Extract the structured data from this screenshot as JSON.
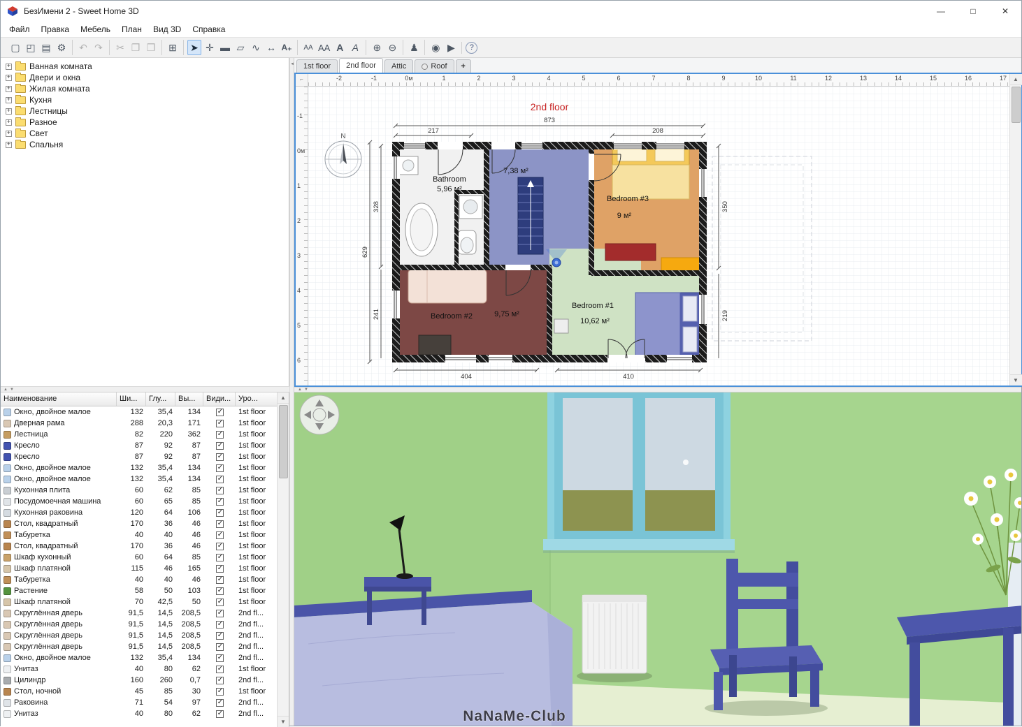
{
  "window": {
    "title": "БезИмени 2 - Sweet Home 3D",
    "controls": {
      "minimize": "—",
      "maximize": "□",
      "close": "✕"
    }
  },
  "menu": {
    "items": [
      "Файл",
      "Правка",
      "Мебель",
      "План",
      "Вид 3D",
      "Справка"
    ]
  },
  "icons": {
    "up": "▲",
    "down": "▼",
    "left": "◄"
  },
  "toolbar": {
    "groups": [
      [
        {
          "name": "new-home-icon",
          "glyph": "▢"
        },
        {
          "name": "open-icon",
          "glyph": "◰"
        },
        {
          "name": "save-icon",
          "glyph": "▤"
        },
        {
          "name": "preferences-icon",
          "glyph": "⚙"
        }
      ],
      [
        {
          "name": "undo-icon",
          "glyph": "↶"
        },
        {
          "name": "redo-icon",
          "glyph": "↷"
        }
      ],
      [
        {
          "name": "cut-icon",
          "glyph": "✂"
        },
        {
          "name": "copy-icon",
          "glyph": "❐"
        },
        {
          "name": "paste-icon",
          "glyph": "❒"
        }
      ],
      [
        {
          "name": "add-furniture-icon",
          "glyph": "⊞"
        }
      ],
      [
        {
          "name": "select-tool-icon",
          "glyph": "➤"
        },
        {
          "name": "pan-tool-icon",
          "glyph": "✛"
        },
        {
          "name": "create-walls-icon",
          "glyph": "▬"
        },
        {
          "name": "create-rooms-icon",
          "glyph": "▱"
        },
        {
          "name": "create-polylines-icon",
          "glyph": "∿"
        },
        {
          "name": "create-dimensions-icon",
          "glyph": "↔"
        },
        {
          "name": "add-text-icon",
          "glyph": "A₊"
        }
      ],
      [
        {
          "name": "decrease-text-size-icon",
          "glyph": "AA"
        },
        {
          "name": "increase-text-size-icon",
          "glyph": "AA"
        },
        {
          "name": "bold-icon",
          "glyph": "A"
        },
        {
          "name": "italic-icon",
          "glyph": "A"
        }
      ],
      [
        {
          "name": "zoom-in-icon",
          "glyph": "⊕"
        },
        {
          "name": "zoom-out-icon",
          "glyph": "⊖"
        }
      ],
      [
        {
          "name": "virtual-visitor-icon",
          "glyph": "♟"
        }
      ],
      [
        {
          "name": "create-photo-icon",
          "glyph": "◉"
        },
        {
          "name": "create-video-icon",
          "glyph": "▶"
        }
      ],
      [
        {
          "name": "help-icon",
          "glyph": "?"
        }
      ]
    ]
  },
  "catalog": {
    "categories": [
      "Ванная комната",
      "Двери и окна",
      "Жилая комната",
      "Кухня",
      "Лестницы",
      "Разное",
      "Свет",
      "Спальня"
    ]
  },
  "furniture_table": {
    "columns": [
      "Наименование",
      "Ши...",
      "Глу...",
      "Вы...",
      "Види...",
      "Уро..."
    ],
    "rows": [
      {
        "icon": "window",
        "name": "Окно, двойное малое",
        "w": "132",
        "d": "35,4",
        "h": "134",
        "visible": true,
        "level": "1st floor"
      },
      {
        "icon": "door-frame",
        "name": "Дверная рама",
        "w": "288",
        "d": "20,3",
        "h": "171",
        "visible": true,
        "level": "1st floor"
      },
      {
        "icon": "staircase",
        "name": "Лестница",
        "w": "82",
        "d": "220",
        "h": "362",
        "visible": true,
        "level": "1st floor"
      },
      {
        "icon": "armchair",
        "name": "Кресло",
        "w": "87",
        "d": "92",
        "h": "87",
        "visible": true,
        "level": "1st floor"
      },
      {
        "icon": "armchair",
        "name": "Кресло",
        "w": "87",
        "d": "92",
        "h": "87",
        "visible": true,
        "level": "1st floor"
      },
      {
        "icon": "window",
        "name": "Окно, двойное малое",
        "w": "132",
        "d": "35,4",
        "h": "134",
        "visible": true,
        "level": "1st floor"
      },
      {
        "icon": "window",
        "name": "Окно, двойное малое",
        "w": "132",
        "d": "35,4",
        "h": "134",
        "visible": true,
        "level": "1st floor"
      },
      {
        "icon": "cooktop",
        "name": "Кухонная плита",
        "w": "60",
        "d": "62",
        "h": "85",
        "visible": true,
        "level": "1st floor"
      },
      {
        "icon": "dishwasher",
        "name": "Посудомоечная машина",
        "w": "60",
        "d": "65",
        "h": "85",
        "visible": true,
        "level": "1st floor"
      },
      {
        "icon": "kitchen-sink",
        "name": "Кухонная раковина",
        "w": "120",
        "d": "64",
        "h": "106",
        "visible": true,
        "level": "1st floor"
      },
      {
        "icon": "table",
        "name": "Стол, квадратный",
        "w": "170",
        "d": "36",
        "h": "46",
        "visible": true,
        "level": "1st floor"
      },
      {
        "icon": "stool",
        "name": "Табуретка",
        "w": "40",
        "d": "40",
        "h": "46",
        "visible": true,
        "level": "1st floor"
      },
      {
        "icon": "table",
        "name": "Стол, квадратный",
        "w": "170",
        "d": "36",
        "h": "46",
        "visible": true,
        "level": "1st floor"
      },
      {
        "icon": "cabinet",
        "name": "Шкаф кухонный",
        "w": "60",
        "d": "64",
        "h": "85",
        "visible": true,
        "level": "1st floor"
      },
      {
        "icon": "wardrobe",
        "name": "Шкаф платяной",
        "w": "115",
        "d": "46",
        "h": "165",
        "visible": true,
        "level": "1st floor"
      },
      {
        "icon": "stool",
        "name": "Табуретка",
        "w": "40",
        "d": "40",
        "h": "46",
        "visible": true,
        "level": "1st floor"
      },
      {
        "icon": "plant",
        "name": "Растение",
        "w": "58",
        "d": "50",
        "h": "103",
        "visible": true,
        "level": "1st floor"
      },
      {
        "icon": "wardrobe",
        "name": "Шкаф платяной",
        "w": "70",
        "d": "42,5",
        "h": "50",
        "visible": true,
        "level": "1st floor"
      },
      {
        "icon": "rounded-door",
        "name": "Скруглённая дверь",
        "w": "91,5",
        "d": "14,5",
        "h": "208,5",
        "visible": true,
        "level": "2nd fl..."
      },
      {
        "icon": "rounded-door",
        "name": "Скруглённая дверь",
        "w": "91,5",
        "d": "14,5",
        "h": "208,5",
        "visible": true,
        "level": "2nd fl..."
      },
      {
        "icon": "rounded-door",
        "name": "Скруглённая дверь",
        "w": "91,5",
        "d": "14,5",
        "h": "208,5",
        "visible": true,
        "level": "2nd fl..."
      },
      {
        "icon": "rounded-door",
        "name": "Скруглённая дверь",
        "w": "91,5",
        "d": "14,5",
        "h": "208,5",
        "visible": true,
        "level": "2nd fl..."
      },
      {
        "icon": "window",
        "name": "Окно, двойное малое",
        "w": "132",
        "d": "35,4",
        "h": "134",
        "visible": true,
        "level": "2nd fl..."
      },
      {
        "icon": "toilet",
        "name": "Унитаз",
        "w": "40",
        "d": "80",
        "h": "62",
        "visible": true,
        "level": "1st floor"
      },
      {
        "icon": "cylinder",
        "name": "Цилиндр",
        "w": "160",
        "d": "260",
        "h": "0,7",
        "visible": true,
        "level": "2nd fl..."
      },
      {
        "icon": "nightstand",
        "name": "Стол, ночной",
        "w": "45",
        "d": "85",
        "h": "30",
        "visible": true,
        "level": "1st floor"
      },
      {
        "icon": "sink",
        "name": "Раковина",
        "w": "71",
        "d": "54",
        "h": "97",
        "visible": true,
        "level": "2nd fl..."
      },
      {
        "icon": "toilet",
        "name": "Унитаз",
        "w": "40",
        "d": "80",
        "h": "62",
        "visible": true,
        "level": "2nd fl..."
      }
    ]
  },
  "plan": {
    "tabs": [
      "1st floor",
      "2nd floor",
      "Attic",
      "Roof"
    ],
    "add_level_label": "+",
    "level_title": "2nd floor",
    "ruler_top": [
      "-2",
      "-1",
      "0м",
      "1",
      "2",
      "3",
      "4",
      "5",
      "6",
      "7",
      "8",
      "9",
      "10",
      "11",
      "12",
      "13",
      "14",
      "15",
      "16",
      "17"
    ],
    "ruler_left": [
      "-1",
      "0м",
      "1",
      "2",
      "3",
      "4",
      "5",
      "6"
    ],
    "compass_label": "N",
    "rooms": [
      {
        "name": "Bathroom",
        "area": "5,96 м²"
      },
      {
        "name": "",
        "area": "7,38 м²"
      },
      {
        "name": "Bedroom #3",
        "area": "9 м²"
      },
      {
        "name": "Bedroom #2",
        "area": "9,75 м²"
      },
      {
        "name": "Bedroom #1",
        "area": "10,62 м²"
      }
    ],
    "dimensions": {
      "top": "873",
      "top_left": "217",
      "top_right": "208",
      "left_total": "629",
      "left_upper": "328",
      "left_lower": "241",
      "right_upper": "350",
      "right_lower": "219",
      "bottom_left": "404",
      "bottom_right": "410"
    }
  },
  "view3d": {
    "watermark": "NaNaMe-Club"
  }
}
